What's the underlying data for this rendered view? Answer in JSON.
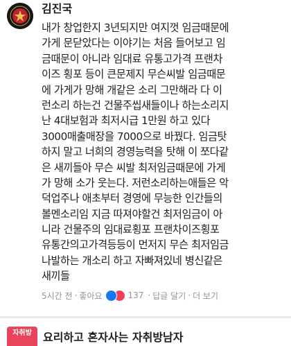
{
  "comment": {
    "author": "김진국",
    "lines": [
      "내가 창업한지 3년되지만 여지껏 임금때문에",
      "가게 문닫았다는 이야기는 처음 들어보고 임",
      "금때문이 아니라 임대료 유통고가격 프랜차",
      "이즈 횡포 등이 큰문제지 무슨씨발 임금때문",
      "에 가게가 망해 개같은 소리 그만해라 다 이",
      "런소리 하는건 건물주씹새들이나 하는소리지",
      "난 4대보험과 최저시급 1만원 하고 있다",
      "3000매출매장을 7000으로 바꿨다. 임금탓",
      "하지 말고 너희의 경영능력을 탓해 이 쪼다같",
      "은 새끼들아 무슨 씨발 최저임금때문에 가게",
      "가 망해 소가 웃는다. 저런소리하는애들은 악",
      "덕업주나 애초부터 경영에 무능한 인간들의",
      "볼멘소리임 지금 따져야할건 최저임금이 아",
      "니라 건물주의 임대료횡포 프랜차이즈횡포",
      "유통간의고가격등등이 먼저지 무슨 최저임금",
      "나발하는 개소리 하고 자빠져있네 병신같은",
      "새끼들"
    ],
    "time": "5시간 전",
    "sep": "·",
    "like_label": "좋아요",
    "reaction_count": "137",
    "reply_label": "답글 달기",
    "more_label": "더 보기",
    "reactions": [
      "like-icon",
      "love-icon"
    ],
    "colors": {
      "like": "#1877f2",
      "love": "#f33e58",
      "meta": "#90949c"
    }
  },
  "next_comment": {
    "avatar_text": "자취방",
    "author": "요리하고 혼자사는 자취방남자"
  }
}
